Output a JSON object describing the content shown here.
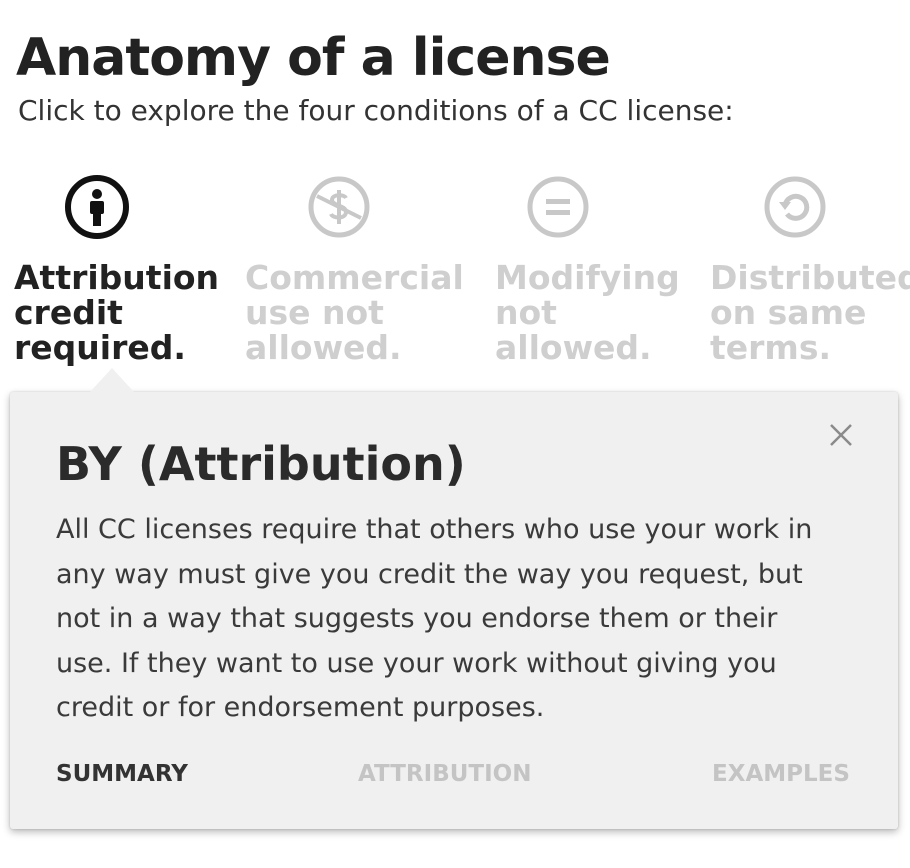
{
  "page": {
    "title": "Anatomy of a license",
    "subtitle": "Click to explore the four conditions of a CC license:"
  },
  "conditions": [
    {
      "id": "by",
      "icon": "attribution-person-icon",
      "lines": [
        "Attribution",
        "credit",
        "required."
      ],
      "active": true
    },
    {
      "id": "nc",
      "icon": "noncommercial-dollar-icon",
      "lines": [
        "Commercial",
        "use not",
        "allowed."
      ],
      "active": false
    },
    {
      "id": "nd",
      "icon": "no-derivatives-equals-icon",
      "lines": [
        "Modifying",
        "not",
        "allowed."
      ],
      "active": false
    },
    {
      "id": "sa",
      "icon": "share-alike-icon",
      "lines": [
        "Distributed",
        "on same",
        "terms."
      ],
      "active": false
    }
  ],
  "panel": {
    "title": "BY (Attribution)",
    "lines": [
      "All CC licenses require that others who use your work in",
      "any way must give you credit the way you request, but",
      "not in a way that suggests you endorse them or their",
      "use. If they want to use your work without giving you",
      "credit or for endorsement purposes."
    ],
    "close_icon": "close-icon",
    "tabs": [
      {
        "label": "SUMMARY",
        "active": true
      },
      {
        "label": "ATTRIBUTION",
        "active": false
      },
      {
        "label": "EXAMPLES",
        "active": false
      }
    ]
  },
  "colors": {
    "active_text": "#222222",
    "inactive_text": "#cfcfcf",
    "panel_bg": "#f0f0f0",
    "tab_inactive": "#c4c4c4"
  }
}
